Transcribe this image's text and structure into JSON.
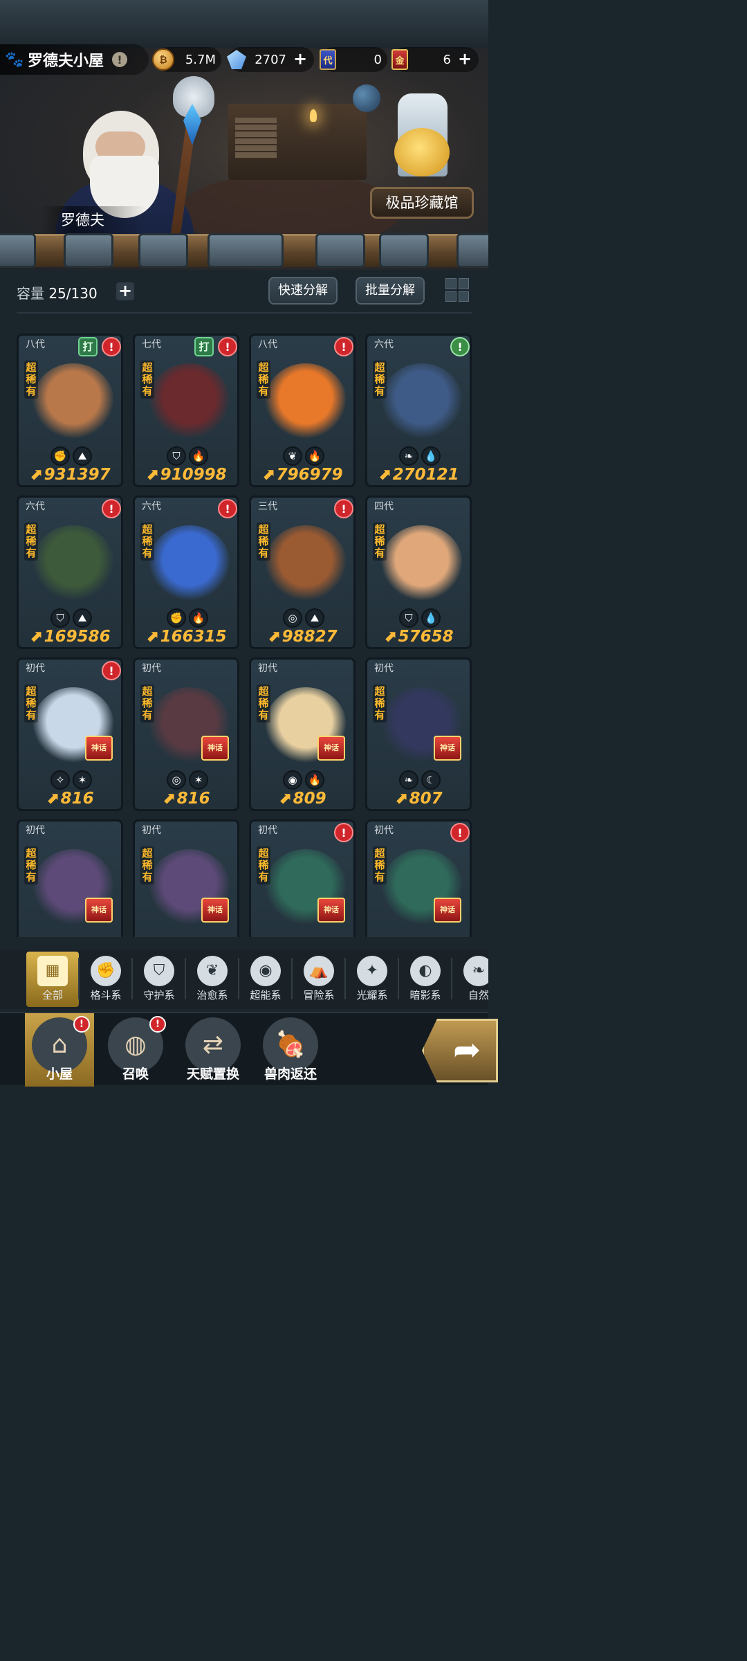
{
  "header": {
    "house_name": "罗德夫小屋",
    "warning_symbol": "!",
    "resources": [
      {
        "name": "gold-coin-icon",
        "value": "5.7M",
        "has_plus": false
      },
      {
        "name": "crystal-icon",
        "value": "2707",
        "has_plus": true
      },
      {
        "name": "blue-card-icon",
        "value": "0",
        "has_plus": false,
        "glyph": "代"
      },
      {
        "name": "red-card-icon",
        "value": "6",
        "has_plus": true,
        "glyph": "金"
      }
    ],
    "plus_glyph": "+"
  },
  "scene": {
    "npc_name": "罗德夫",
    "treasure_hall": "极品珍藏馆"
  },
  "storage": {
    "capacity_label": "容量",
    "capacity_value": "25/130",
    "plus_glyph": "+",
    "quick_decompose": "快速分解",
    "batch_decompose": "批量分解"
  },
  "pets": [
    {
      "gen": "八代",
      "rarity": "超稀有",
      "fight_badge": "打",
      "alert": "red",
      "types": [
        "fist-icon",
        "earth-icon"
      ],
      "power": "931397",
      "art": "#b8784a"
    },
    {
      "gen": "七代",
      "rarity": "超稀有",
      "fight_badge": "打",
      "alert": "red",
      "types": [
        "shield-icon",
        "fire-icon"
      ],
      "power": "910998",
      "art": "#6a2a2e"
    },
    {
      "gen": "八代",
      "rarity": "超稀有",
      "fight_badge": "",
      "alert": "red",
      "types": [
        "leaf-icon",
        "fire-icon"
      ],
      "power": "796979",
      "art": "#e8782a"
    },
    {
      "gen": "六代",
      "rarity": "超稀有",
      "fight_badge": "",
      "alert": "green",
      "types": [
        "feather-icon",
        "water-icon"
      ],
      "power": "270121",
      "art": "#3e5a86"
    },
    {
      "gen": "六代",
      "rarity": "超稀有",
      "fight_badge": "",
      "alert": "red",
      "types": [
        "shield-icon",
        "earth-icon"
      ],
      "power": "169586",
      "art": "#3d5a3a"
    },
    {
      "gen": "六代",
      "rarity": "超稀有",
      "fight_badge": "",
      "alert": "red",
      "types": [
        "fist-icon",
        "fire-icon"
      ],
      "power": "166315",
      "art": "#3a6ad0"
    },
    {
      "gen": "三代",
      "rarity": "超稀有",
      "fight_badge": "",
      "alert": "red",
      "types": [
        "psychic-icon",
        "earth-icon"
      ],
      "power": "98827",
      "art": "#9a5a32"
    },
    {
      "gen": "四代",
      "rarity": "超稀有",
      "fight_badge": "",
      "alert": "",
      "types": [
        "shield-icon",
        "water-icon"
      ],
      "power": "57658",
      "art": "#e0a87a"
    },
    {
      "gen": "初代",
      "rarity": "超稀有",
      "fight_badge": "",
      "alert": "red",
      "types": [
        "light-icon",
        "star-icon"
      ],
      "power": "816",
      "art": "#c9d8e8",
      "mythic": "神话"
    },
    {
      "gen": "初代",
      "rarity": "超稀有",
      "fight_badge": "",
      "alert": "",
      "types": [
        "psychic-icon",
        "star-icon"
      ],
      "power": "816",
      "art": "#5a3a42",
      "mythic": "神话"
    },
    {
      "gen": "初代",
      "rarity": "超稀有",
      "fight_badge": "",
      "alert": "",
      "types": [
        "alien-icon",
        "fire-icon"
      ],
      "power": "809",
      "art": "#e8d0a0",
      "mythic": "神话"
    },
    {
      "gen": "初代",
      "rarity": "超稀有",
      "fight_badge": "",
      "alert": "",
      "types": [
        "feather-icon",
        "moon-icon"
      ],
      "power": "807",
      "art": "#33385e",
      "mythic": "神话"
    },
    {
      "gen": "初代",
      "rarity": "超稀有",
      "fight_badge": "",
      "alert": "",
      "types": [],
      "power": "",
      "art": "#5e4a78",
      "mythic": "神话"
    },
    {
      "gen": "初代",
      "rarity": "超稀有",
      "fight_badge": "",
      "alert": "",
      "types": [],
      "power": "",
      "art": "#5e4a78",
      "mythic": "神话"
    },
    {
      "gen": "初代",
      "rarity": "超稀有",
      "fight_badge": "",
      "alert": "red",
      "types": [],
      "power": "",
      "art": "#2f6a5a",
      "mythic": "神话"
    },
    {
      "gen": "初代",
      "rarity": "超稀有",
      "fight_badge": "",
      "alert": "red",
      "types": [],
      "power": "",
      "art": "#2f6a5a",
      "mythic": "神话"
    }
  ],
  "filters": [
    {
      "label": "全部",
      "icon": "grid-blocks-icon",
      "glyph": "▦",
      "active": true
    },
    {
      "label": "格斗系",
      "icon": "fist-icon",
      "glyph": "✊",
      "active": false
    },
    {
      "label": "守护系",
      "icon": "shield-icon",
      "glyph": "⛉",
      "active": false
    },
    {
      "label": "治愈系",
      "icon": "sprout-icon",
      "glyph": "❦",
      "active": false
    },
    {
      "label": "超能系",
      "icon": "alien-icon",
      "glyph": "◉",
      "active": false
    },
    {
      "label": "冒险系",
      "icon": "lantern-icon",
      "glyph": "⛺",
      "active": false
    },
    {
      "label": "光耀系",
      "icon": "crosshair-star-icon",
      "glyph": "✦",
      "active": false
    },
    {
      "label": "暗影系",
      "icon": "eclipse-icon",
      "glyph": "◐",
      "active": false
    },
    {
      "label": "自然",
      "icon": "feather-icon",
      "glyph": "❧",
      "active": false
    }
  ],
  "nav": [
    {
      "label": "小屋",
      "icon": "house-icon",
      "glyph": "⌂",
      "active": true,
      "badge": "!"
    },
    {
      "label": "召唤",
      "icon": "egg-icon",
      "glyph": "◍",
      "active": false,
      "badge": "!"
    },
    {
      "label": "天赋置换",
      "icon": "swap-arrows-icon",
      "glyph": "⇄",
      "active": false,
      "badge": ""
    },
    {
      "label": "兽肉返还",
      "icon": "meat-icon",
      "glyph": "🍖",
      "active": false,
      "badge": ""
    }
  ],
  "type_glyphs": {
    "fist-icon": "✊",
    "earth-icon": "⛰",
    "shield-icon": "⛉",
    "fire-icon": "🔥",
    "leaf-icon": "❦",
    "feather-icon": "❧",
    "water-icon": "💧",
    "psychic-icon": "◎",
    "light-icon": "✧",
    "star-icon": "✶",
    "alien-icon": "◉",
    "moon-icon": "☾"
  },
  "colors": {
    "power": "#ffba38",
    "rarity": "#ffba2a",
    "alert_red": "#d0262b",
    "alert_green": "#3b8e46",
    "active_gold": "#d9b34c"
  }
}
